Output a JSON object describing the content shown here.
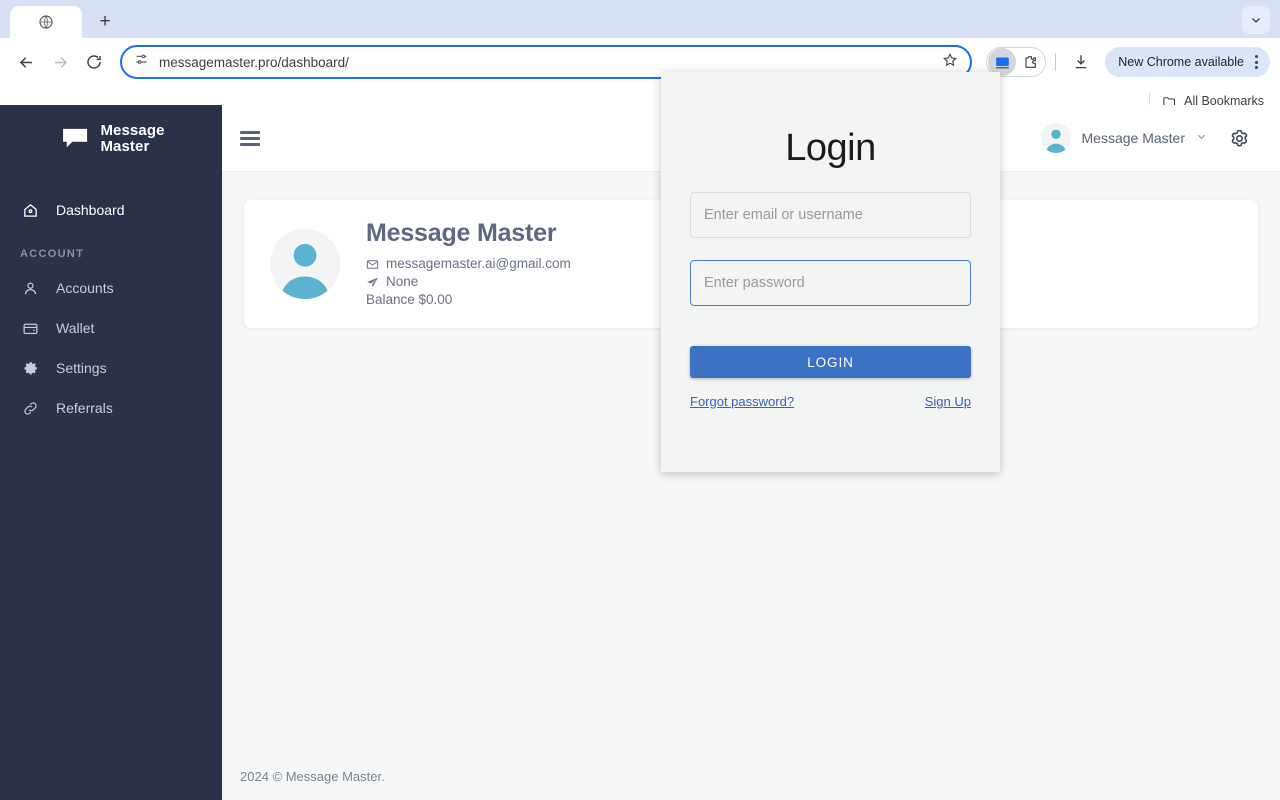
{
  "browser": {
    "tab": {
      "favicon": "globe-icon",
      "title": ""
    },
    "new_tab_label": "+",
    "tab_search_icon": "chevron-down-icon",
    "back_icon": "back-arrow-icon",
    "forward_icon": "forward-arrow-icon",
    "reload_icon": "reload-icon",
    "site_info_icon": "tune-icon",
    "url": "messagemaster.pro/dashboard/",
    "bookmark_star_icon": "star-icon",
    "screencast_icon": "screencast-icon",
    "extensions_icon": "extensions-icon",
    "download_icon": "download-icon",
    "update_label": "New Chrome available",
    "menu_icon": "kebab-menu-icon",
    "bookmarks": {
      "folder_icon": "folder-icon",
      "label": "All Bookmarks"
    }
  },
  "sidebar": {
    "logo_icon": "speech-bubble-icon",
    "brand_line1": "Message",
    "brand_line2": "Master",
    "items": [
      {
        "label": "Dashboard",
        "icon": "home-icon",
        "active": true
      }
    ],
    "section_label": "ACCOUNT",
    "account_items": [
      {
        "label": "Accounts",
        "icon": "person-icon"
      },
      {
        "label": "Wallet",
        "icon": "wallet-icon"
      },
      {
        "label": "Settings",
        "icon": "gear-icon"
      },
      {
        "label": "Referrals",
        "icon": "link-icon"
      }
    ]
  },
  "topbar": {
    "menu_toggle_icon": "hamburger-icon",
    "user_avatar_icon": "avatar-icon",
    "user_name": "Message Master",
    "dropdown_icon": "chevron-down-icon",
    "settings_icon": "gear-icon"
  },
  "profile": {
    "avatar_icon": "avatar-icon",
    "name": "Message Master",
    "email_icon": "envelope-icon",
    "email": "messagemaster.ai@gmail.com",
    "telegram_icon": "paper-plane-icon",
    "telegram": "None",
    "balance": "Balance $0.00"
  },
  "footer": {
    "copyright": "2024 © Message Master."
  },
  "login_modal": {
    "title": "Login",
    "username_placeholder": "Enter email or username",
    "username_value": "",
    "password_placeholder": "Enter password",
    "password_value": "",
    "submit_label": "LOGIN",
    "forgot_label": "Forgot password?",
    "signup_label": "Sign Up"
  },
  "colors": {
    "sidebar_bg": "#2b3248",
    "accent_blue": "#3b72c4",
    "avatar_blue": "#5bb3d0",
    "page_bg": "#f6f7f9",
    "text_muted": "#6b7285"
  }
}
